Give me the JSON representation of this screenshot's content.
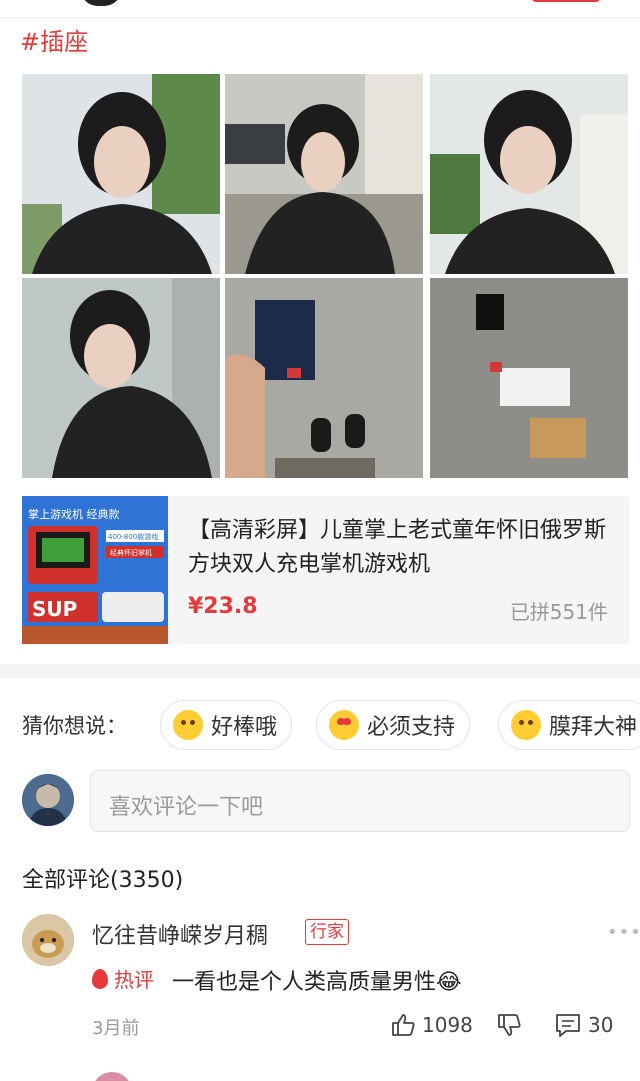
{
  "post": {
    "hashtag": "#插座",
    "photos": [
      "selfie-1",
      "selfie-2",
      "selfie-3",
      "selfie-4",
      "game-box-in-hand",
      "game-items-on-ground"
    ]
  },
  "product": {
    "title": "【高清彩屏】儿童掌上老式童年怀旧俄罗斯方块双人充电掌机游戏机",
    "price": "¥23.8",
    "sold": "已拼551件",
    "thumb_text": {
      "top": "掌上游戏机  经典款",
      "games": "400-800款游戏",
      "sub": "经典怀旧掌机",
      "brand": "SUP"
    }
  },
  "guess": {
    "label": "猜你想说：",
    "chips": [
      "好棒哦",
      "必须支持",
      "膜拜大神"
    ]
  },
  "comment_input": {
    "placeholder": "喜欢评论一下吧"
  },
  "comments_header": "全部评论(3350)",
  "comment": {
    "name": "忆往昔峥嵘岁月稠",
    "badge": "行家",
    "hot_label": "热评",
    "text": "一看也是个人类高质量男性😂",
    "time": "3月前",
    "likes": "1098",
    "replies": "30"
  },
  "colors": {
    "accent": "#e23b3b",
    "muted": "#999999"
  }
}
